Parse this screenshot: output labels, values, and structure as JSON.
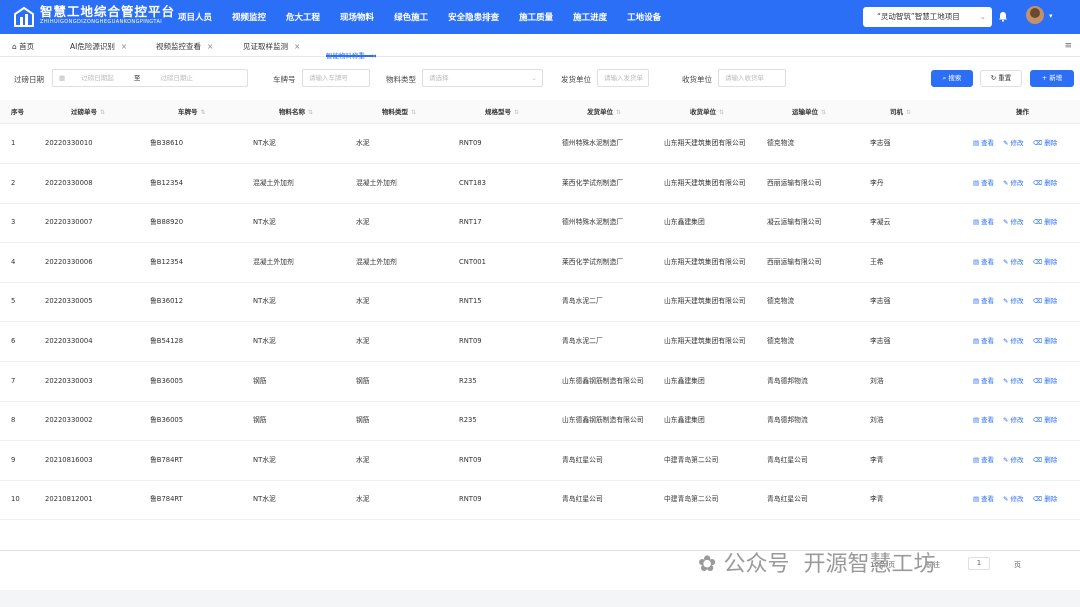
{
  "header": {
    "title": "智慧工地综合管控平台",
    "subtitle": "ZHIHUIGONGDIZONGHEGUANKONGPINGTAI",
    "nav": [
      "项目人员",
      "视频监控",
      "危大工程",
      "现场物料",
      "绿色施工",
      "安全隐患排查",
      "施工质量",
      "施工进度",
      "工地设备"
    ],
    "project": "“灵动智筑”智慧工地项目"
  },
  "tabs": [
    {
      "label": "首页"
    },
    {
      "label": "AI危险源识别"
    },
    {
      "label": "视频监控查看"
    },
    {
      "label": "见证取样监测"
    },
    {
      "label": "智能物料称重"
    }
  ],
  "filters": {
    "date_label": "过磅日期",
    "date_start": "过磅日期起",
    "date_to": "至",
    "date_end": "过磅日期止",
    "plate_label": "车牌号",
    "plate_ph": "请输入车牌号",
    "type_label": "物料类型",
    "type_ph": "请选择",
    "sender_label": "发货单位",
    "sender_ph": "请输入发货单",
    "receiver_label": "收货单位",
    "receiver_ph": "请输入收货单"
  },
  "buttons": {
    "search": "搜索",
    "reset": "重置",
    "add": "+ 新增"
  },
  "table": {
    "columns": [
      "序号",
      "过磅单号",
      "车牌号",
      "物料名称",
      "物料类型",
      "规格型号",
      "发货单位",
      "收货单位",
      "运输单位",
      "司机",
      "操作"
    ],
    "actions": [
      "查看",
      "修改",
      "删除"
    ],
    "rows": [
      [
        "1",
        "20220330010",
        "鲁B38610",
        "NT水泥",
        "水泥",
        "RNT09",
        "德州特殊水泥制造厂",
        "山东翔天建筑集团有限公司",
        "德克物流",
        "李志强"
      ],
      [
        "2",
        "20220330008",
        "鲁B12354",
        "混凝土外加剂",
        "混凝土外加剂",
        "CNT183",
        "莱西化学试剂制造厂",
        "山东翔天建筑集团有限公司",
        "西丽运输有限公司",
        "李丹"
      ],
      [
        "3",
        "20220330007",
        "鲁B88920",
        "NT水泥",
        "水泥",
        "RNT17",
        "德州特殊水泥制造厂",
        "山东鑫建集团",
        "凝云运输有限公司",
        "李凝云"
      ],
      [
        "4",
        "20220330006",
        "鲁B12354",
        "混凝土外加剂",
        "混凝土外加剂",
        "CNT001",
        "莱西化学试剂制造厂",
        "山东翔天建筑集团有限公司",
        "西丽运输有限公司",
        "王希"
      ],
      [
        "5",
        "20220330005",
        "鲁B36012",
        "NT水泥",
        "水泥",
        "RNT15",
        "青岛水泥二厂",
        "山东翔天建筑集团有限公司",
        "德克物流",
        "李志强"
      ],
      [
        "6",
        "20220330004",
        "鲁B54128",
        "NT水泥",
        "水泥",
        "RNT09",
        "青岛水泥二厂",
        "山东翔天建筑集团有限公司",
        "德克物流",
        "李志强"
      ],
      [
        "7",
        "20220330003",
        "鲁B36005",
        "钢筋",
        "钢筋",
        "R235",
        "山东德鑫钢筋制造有限公司",
        "山东鑫建集团",
        "青岛德邦物流",
        "刘浩"
      ],
      [
        "8",
        "20220330002",
        "鲁B36005",
        "钢筋",
        "钢筋",
        "R235",
        "山东德鑫钢筋制造有限公司",
        "山东鑫建集团",
        "青岛德邦物流",
        "刘浩"
      ],
      [
        "9",
        "20210816003",
        "鲁B784RT",
        "NT水泥",
        "水泥",
        "RNT09",
        "青岛红星公司",
        "中建青岛第二公司",
        "青岛红星公司",
        "李青"
      ],
      [
        "10",
        "20210812001",
        "鲁B784RT",
        "NT水泥",
        "水泥",
        "RNT09",
        "青岛红星公司",
        "中建青岛第二公司",
        "青岛红星公司",
        "李青"
      ]
    ]
  },
  "pager": {
    "size": "10条/页",
    "goto": "前往",
    "page": "1",
    "unit": "页"
  },
  "watermark": {
    "left": "公众号",
    "right": "开源智慧工坊"
  },
  "colors": {
    "primary": "#2a6ff5",
    "header": "#2a6ff5"
  }
}
